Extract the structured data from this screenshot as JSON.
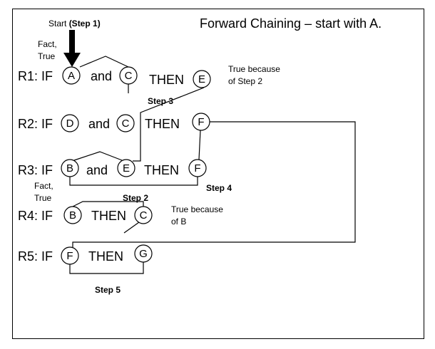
{
  "title": "Forward Chaining – start with A.",
  "start": {
    "prefix": "Start ",
    "step": "(Step 1)"
  },
  "fact_note": {
    "line1": "Fact,",
    "line2": "True"
  },
  "rules": [
    {
      "label": "R1: IF",
      "conj": "and",
      "then": "THEN",
      "nodes": [
        "A",
        "C"
      ],
      "result": "E"
    },
    {
      "label": "R2: IF",
      "conj": "and",
      "then": "THEN",
      "nodes": [
        "D",
        "C"
      ],
      "result": "F"
    },
    {
      "label": "R3: IF",
      "conj": "and",
      "then": "THEN",
      "nodes": [
        "B",
        "E"
      ],
      "result": "F"
    },
    {
      "label": "R4: IF",
      "then": "THEN",
      "nodes": [
        "B"
      ],
      "result": "C"
    },
    {
      "label": "R5: IF",
      "then": "THEN",
      "nodes": [
        "F"
      ],
      "result": "G"
    }
  ],
  "notes": {
    "r1_true": {
      "line1": "True because",
      "line2": "of Step 2"
    },
    "r3_fact": {
      "line1": "Fact,",
      "line2": "True"
    },
    "r4_true": {
      "line1": "True because",
      "line2": "of B"
    }
  },
  "steps": {
    "step2": "Step 2",
    "step3": "Step 3",
    "step4": "Step 4",
    "step5": "Step 5"
  }
}
